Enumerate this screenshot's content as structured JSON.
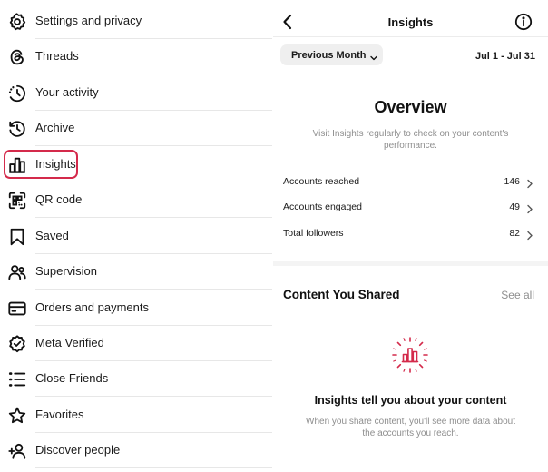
{
  "menu": {
    "items": [
      {
        "label": "Settings and privacy",
        "icon": "gear-icon"
      },
      {
        "label": "Threads",
        "icon": "threads-icon"
      },
      {
        "label": "Your activity",
        "icon": "activity-icon"
      },
      {
        "label": "Archive",
        "icon": "archive-icon"
      },
      {
        "label": "Insights",
        "icon": "insights-chart-icon"
      },
      {
        "label": "QR code",
        "icon": "qr-code-icon"
      },
      {
        "label": "Saved",
        "icon": "bookmark-icon"
      },
      {
        "label": "Supervision",
        "icon": "supervision-icon"
      },
      {
        "label": "Orders and payments",
        "icon": "card-icon"
      },
      {
        "label": "Meta Verified",
        "icon": "verified-badge-icon"
      },
      {
        "label": "Close Friends",
        "icon": "close-friends-list-icon"
      },
      {
        "label": "Favorites",
        "icon": "star-icon"
      },
      {
        "label": "Discover people",
        "icon": "add-person-icon"
      }
    ],
    "highlight_color": "#d42a4b"
  },
  "insights": {
    "header_title": "Insights",
    "period_label": "Previous Month",
    "date_range": "Jul 1 - Jul 31",
    "overview": {
      "title": "Overview",
      "subtitle": "Visit Insights regularly to check on your content's performance."
    },
    "stats": [
      {
        "name": "Accounts reached",
        "value": "146"
      },
      {
        "name": "Accounts engaged",
        "value": "49"
      },
      {
        "name": "Total followers",
        "value": "82"
      }
    ],
    "content_shared": {
      "title": "Content You Shared",
      "see_all": "See all",
      "empty_title": "Insights tell you about your content",
      "empty_subtitle": "When you share content, you'll see more data about the accounts you reach."
    },
    "accent_color": "#d42a4b"
  }
}
